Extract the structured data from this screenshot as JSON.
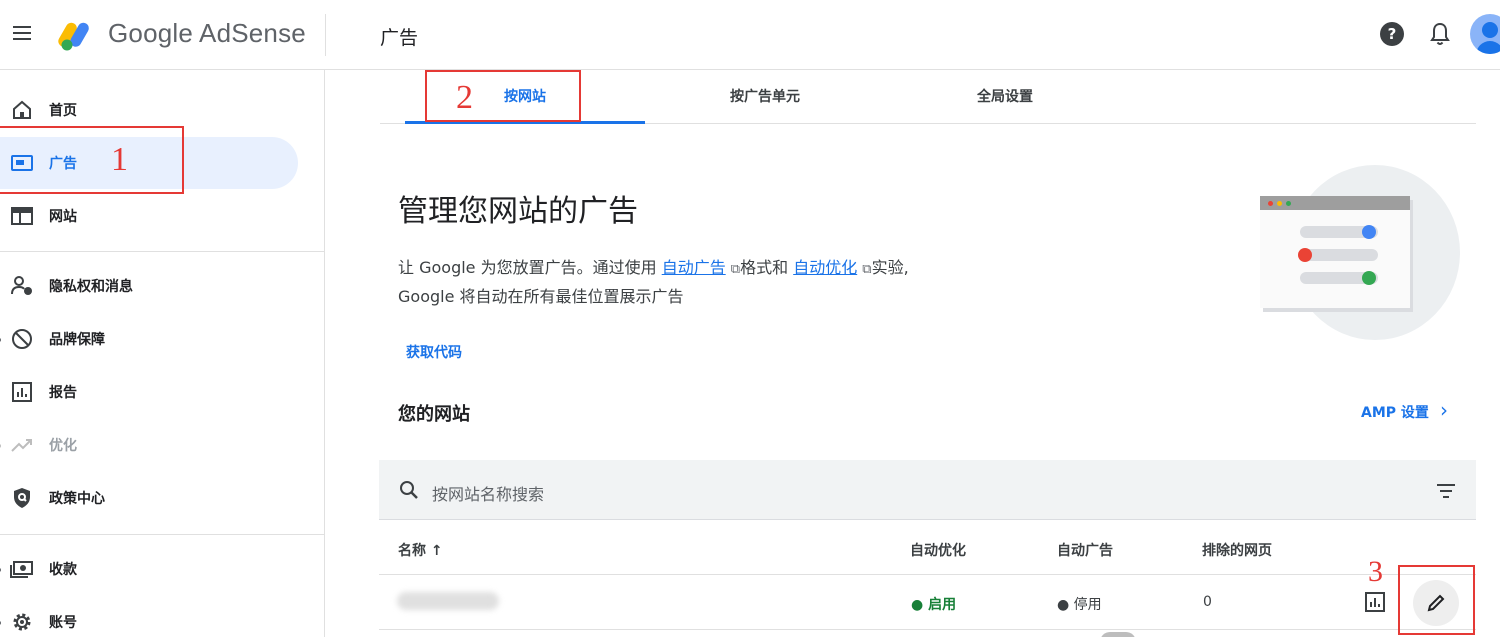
{
  "app": {
    "brand": "Google AdSense",
    "page_title": "广告",
    "help_symbol": "?"
  },
  "sidebar": {
    "items": [
      {
        "label": "首页",
        "icon": "home-icon"
      },
      {
        "label": "广告",
        "icon": "ads-icon",
        "active": true
      },
      {
        "label": "网站",
        "icon": "sites-icon"
      },
      {
        "label": "隐私权和消息",
        "icon": "privacy-icon"
      },
      {
        "label": "品牌保障",
        "icon": "block-icon"
      },
      {
        "label": "报告",
        "icon": "reports-icon"
      },
      {
        "label": "优化",
        "icon": "trending-icon",
        "disabled": true
      },
      {
        "label": "政策中心",
        "icon": "policy-shield-icon"
      },
      {
        "label": "收款",
        "icon": "payments-icon"
      },
      {
        "label": "账号",
        "icon": "gear-icon"
      }
    ]
  },
  "tabs": [
    {
      "label": "按网站",
      "active": true
    },
    {
      "label": "按广告单元"
    },
    {
      "label": "全局设置"
    }
  ],
  "annotations": [
    "1",
    "2",
    "3"
  ],
  "main": {
    "heading": "管理您网站的广告",
    "desc_prefix": "让 Google 为您放置广告。通过使用 ",
    "link_auto_ads": "自动广告",
    "desc_mid": "格式和 ",
    "link_auto_opt": "自动优化",
    "desc_suffix": "实验,",
    "desc_line2": "Google 将自动在所有最佳位置展示广告",
    "get_code": "获取代码",
    "your_sites": "您的网站",
    "amp_settings": "AMP 设置"
  },
  "table": {
    "search_placeholder": "按网站名称搜索",
    "headers": {
      "name": "名称 ↑",
      "auto_optimize": "自动优化",
      "auto_ads": "自动广告",
      "excluded_pages": "排除的网页"
    },
    "rows": [
      {
        "auto_optimize": "● 启用",
        "auto_ads": "● 停用",
        "excluded_pages": "0"
      }
    ]
  },
  "colors": {
    "accent": "#1a73e8",
    "active_bg": "#e8f0fe",
    "annotation": "#e53935",
    "enabled": "#188038"
  }
}
